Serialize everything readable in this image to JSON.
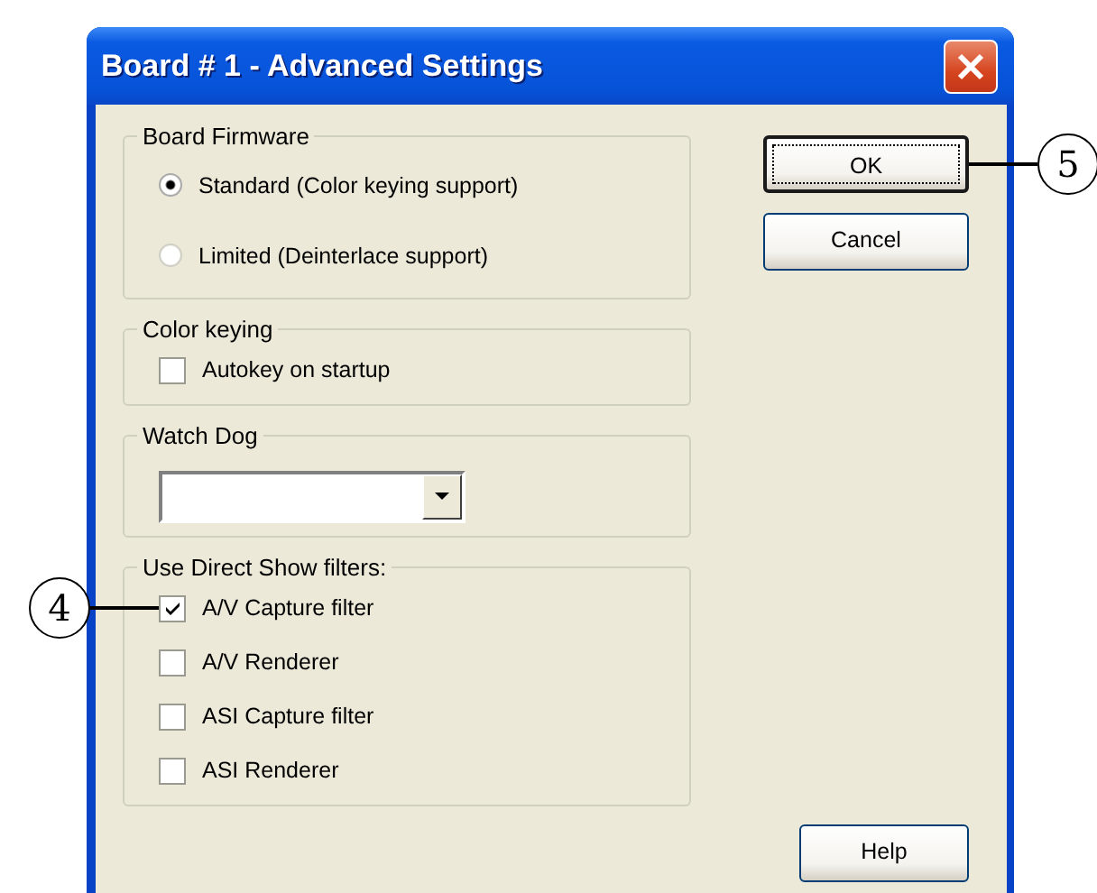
{
  "window": {
    "title": "Board # 1 - Advanced Settings"
  },
  "groups": [
    {
      "title": "Board Firmware",
      "controls": [
        {
          "kind": "radio",
          "label": "Standard (Color keying support)",
          "selected": true
        },
        {
          "kind": "radio",
          "label": "Limited (Deinterlace support)",
          "selected": false
        }
      ]
    },
    {
      "title": "Color keying",
      "controls": [
        {
          "kind": "checkbox",
          "label": "Autokey on startup",
          "checked": false
        }
      ]
    },
    {
      "title": "Watch Dog",
      "controls": [
        {
          "kind": "dropdown"
        }
      ]
    },
    {
      "title": "Use Direct Show filters:",
      "controls": [
        {
          "kind": "checkbox",
          "label": "A/V Capture filter",
          "checked": true,
          "callout": "4"
        },
        {
          "kind": "checkbox",
          "label": "A/V Renderer",
          "checked": false
        },
        {
          "kind": "checkbox",
          "label": "ASI Capture filter",
          "checked": false
        },
        {
          "kind": "checkbox",
          "label": "ASI Renderer",
          "checked": false
        }
      ]
    }
  ],
  "buttons": [
    {
      "label": "OK",
      "default": true,
      "callout": "5"
    },
    {
      "label": "Cancel",
      "default": false
    },
    {
      "label": "Help",
      "default": false
    }
  ]
}
